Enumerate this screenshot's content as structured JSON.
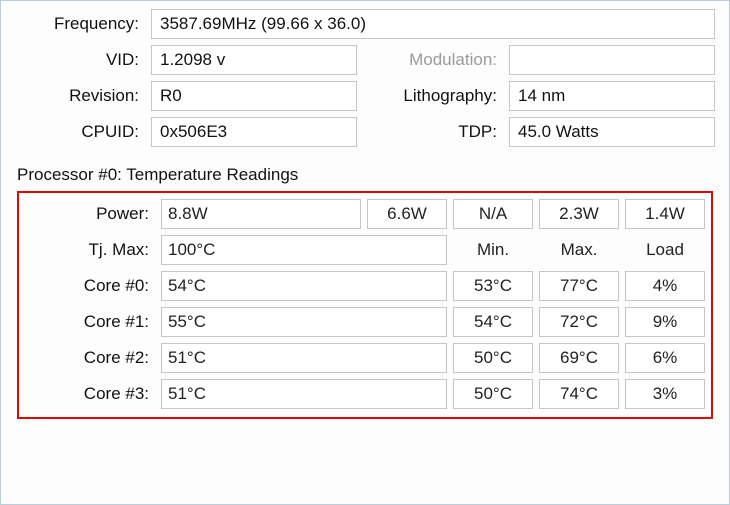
{
  "info": {
    "frequency_label": "Frequency:",
    "frequency_value": "3587.69MHz (99.66 x 36.0)",
    "vid_label": "VID:",
    "vid_value": "1.2098 v",
    "modulation_label": "Modulation:",
    "modulation_value": "",
    "revision_label": "Revision:",
    "revision_value": "R0",
    "lithography_label": "Lithography:",
    "lithography_value": "14 nm",
    "cpuid_label": "CPUID:",
    "cpuid_value": "0x506E3",
    "tdp_label": "TDP:",
    "tdp_value": "45.0 Watts"
  },
  "section_title": "Processor #0: Temperature Readings",
  "temp": {
    "power_label": "Power:",
    "power": {
      "p0": "8.8W",
      "p1": "6.6W",
      "p2": "N/A",
      "p3": "2.3W",
      "p4": "1.4W"
    },
    "tjmax_label": "Tj. Max:",
    "tjmax_value": "100°C",
    "headers": {
      "min": "Min.",
      "max": "Max.",
      "load": "Load"
    },
    "cores": [
      {
        "label": "Core #0:",
        "cur": "54°C",
        "min": "53°C",
        "max": "77°C",
        "load": "4%"
      },
      {
        "label": "Core #1:",
        "cur": "55°C",
        "min": "54°C",
        "max": "72°C",
        "load": "9%"
      },
      {
        "label": "Core #2:",
        "cur": "51°C",
        "min": "50°C",
        "max": "69°C",
        "load": "6%"
      },
      {
        "label": "Core #3:",
        "cur": "51°C",
        "min": "50°C",
        "max": "74°C",
        "load": "3%"
      }
    ]
  }
}
